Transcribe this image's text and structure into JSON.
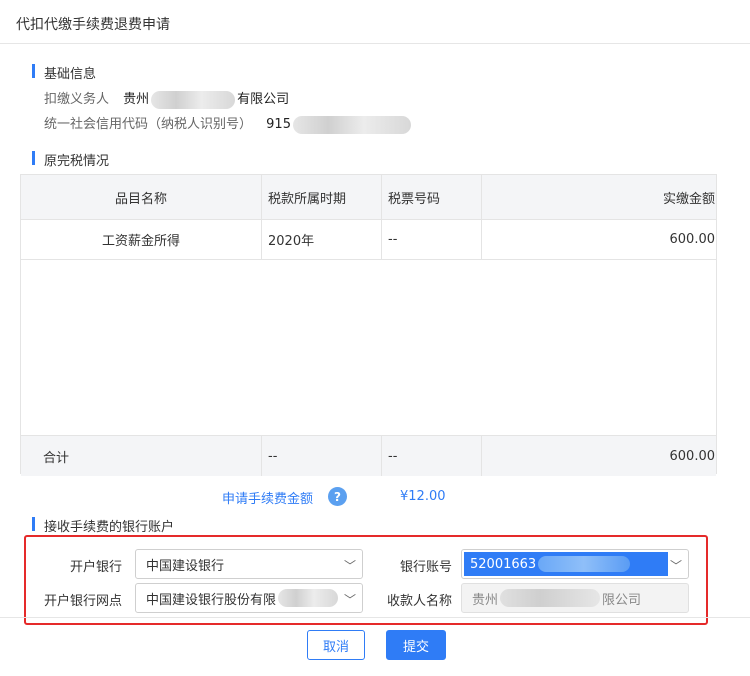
{
  "dialog": {
    "title": "代扣代缴手续费退费申请"
  },
  "basic_info": {
    "title": "基础信息",
    "withholder_label": "扣缴义务人",
    "withholder_value_prefix": "贵州",
    "withholder_value_suffix": "有限公司",
    "credit_code_label": "统一社会信用代码（纳税人识别号）",
    "credit_code_value_prefix": "915"
  },
  "tax_paid": {
    "title": "原完税情况",
    "columns": [
      "品目名称",
      "税款所属时期",
      "税票号码",
      "实缴金额"
    ],
    "rows": [
      {
        "item": "工资薪金所得",
        "period": "2020年",
        "ticket": "--",
        "amount": "600.00"
      }
    ],
    "total": {
      "label": "合计",
      "period": "--",
      "ticket": "--",
      "amount": "600.00"
    }
  },
  "fee": {
    "label": "申请手续费金额",
    "help": "?",
    "value": "¥12.00"
  },
  "bank_account": {
    "title": "接收手续费的银行账户",
    "bank_label": "开户银行",
    "bank_value": "中国建设银行",
    "account_label": "银行账号",
    "account_value": "52001663",
    "branch_label": "开户银行网点",
    "branch_value": "中国建设银行股份有限",
    "payee_label": "收款人名称",
    "payee_value_prefix": "贵州",
    "payee_value_suffix": "限公司"
  },
  "actions": {
    "cancel": "取消",
    "submit": "提交"
  },
  "colors": {
    "accent": "#2f7cf6",
    "highlight_border": "#e52a2a"
  }
}
